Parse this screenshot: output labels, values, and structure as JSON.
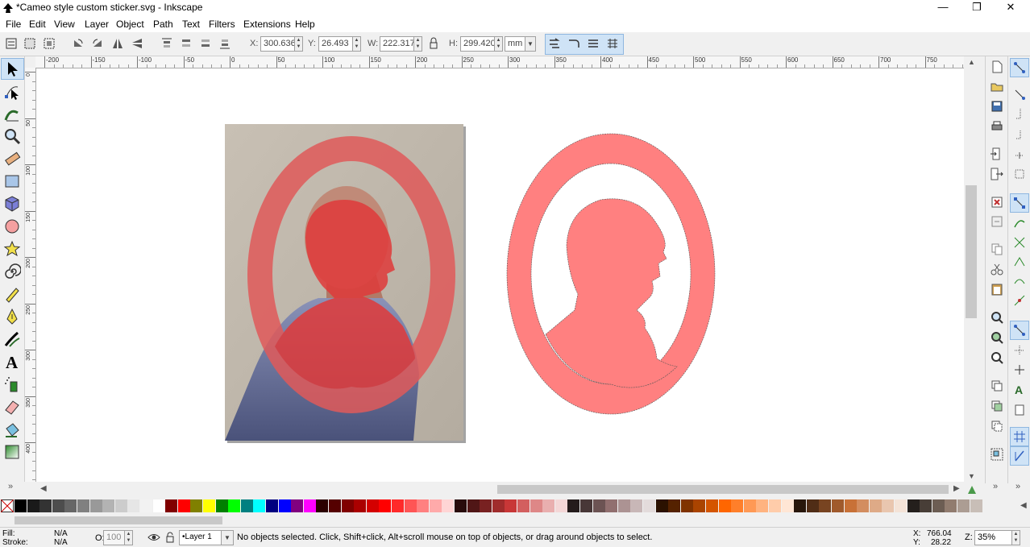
{
  "window": {
    "title": "*Cameo style custom sticker.svg - Inkscape",
    "controls": {
      "minimize": "—",
      "maximize": "❐",
      "close": "✕"
    }
  },
  "menu": [
    "File",
    "Edit",
    "View",
    "Layer",
    "Object",
    "Path",
    "Text",
    "Filters",
    "Extensions",
    "Help"
  ],
  "toolbar": {
    "x_label": "X:",
    "x_value": "300.636",
    "y_label": "Y:",
    "y_value": "26.493",
    "w_label": "W:",
    "w_value": "222.317",
    "h_label": "H:",
    "h_value": "299.420",
    "unit": "mm"
  },
  "ruler": {
    "h_labels": [
      "-200",
      "-150",
      "-100",
      "-50",
      "0",
      "50",
      "100",
      "150",
      "200",
      "250",
      "300",
      "350",
      "400",
      "450",
      "500",
      "550",
      "600",
      "650",
      "700",
      "750"
    ],
    "v_labels": [
      "0",
      "50",
      "100",
      "150",
      "200",
      "250",
      "300",
      "350",
      "400",
      "450"
    ]
  },
  "tools": [
    "selector-icon",
    "node-icon",
    "tweak-icon",
    "zoom-icon",
    "measure-icon",
    "rect-icon",
    "box3d-icon",
    "ellipse-icon",
    "star-icon",
    "spiral-icon",
    "pencil-icon",
    "pen-icon",
    "calligraphy-icon",
    "text-icon",
    "spray-icon",
    "eraser-icon",
    "bucket-icon",
    "gradient-icon"
  ],
  "palette": {
    "colors": [
      "#000000",
      "#1a1a1a",
      "#333333",
      "#4d4d4d",
      "#666666",
      "#808080",
      "#999999",
      "#b3b3b3",
      "#cccccc",
      "#e6e6e6",
      "#f2f2f2",
      "#ffffff",
      "#800000",
      "#ff0000",
      "#808000",
      "#ffff00",
      "#008000",
      "#00ff00",
      "#008080",
      "#00ffff",
      "#000080",
      "#0000ff",
      "#800080",
      "#ff00ff",
      "#2b0000",
      "#550000",
      "#800000",
      "#aa0000",
      "#d40000",
      "#ff0000",
      "#ff2a2a",
      "#ff5555",
      "#ff8080",
      "#ffaaaa",
      "#ffd5d5",
      "#280b0b",
      "#501616",
      "#782121",
      "#a02c2c",
      "#c83737",
      "#d35f5f",
      "#de8787",
      "#e9afaf",
      "#f4d7d7",
      "#241c1c",
      "#483737",
      "#6c5353",
      "#916f6f",
      "#ac9393",
      "#c8b7b7",
      "#e3dbdb",
      "#2b1100",
      "#552200",
      "#803300",
      "#aa4400",
      "#d45500",
      "#ff6600",
      "#ff7f2a",
      "#ff9955",
      "#ffb380",
      "#ffccaa",
      "#ffe6d5",
      "#28170b",
      "#502d16",
      "#784421",
      "#a05a2c",
      "#c87137",
      "#d38d5f",
      "#deaa87",
      "#e9c6af",
      "#f4e3d7",
      "#241f1c",
      "#483e37",
      "#6c5d53",
      "#917c6f",
      "#ac9d93",
      "#c8beb7"
    ]
  },
  "status": {
    "fill_label": "Fill:",
    "fill_value": "N/A",
    "stroke_label": "Stroke:",
    "stroke_value": "N/A",
    "opacity_label": "O:",
    "opacity_value": "100",
    "layer": "•Layer 1",
    "message": "No objects selected. Click, Shift+click, Alt+scroll mouse on top of objects, or drag around objects to select.",
    "x_label": "X:",
    "x_value": "766.04",
    "y_label": "Y:",
    "y_value": "28.22",
    "zoom_label": "Z:",
    "zoom_value": "35%"
  },
  "colors": {
    "sticker_fill": "#ff8080",
    "overlay_fill": "#e05a5a"
  }
}
